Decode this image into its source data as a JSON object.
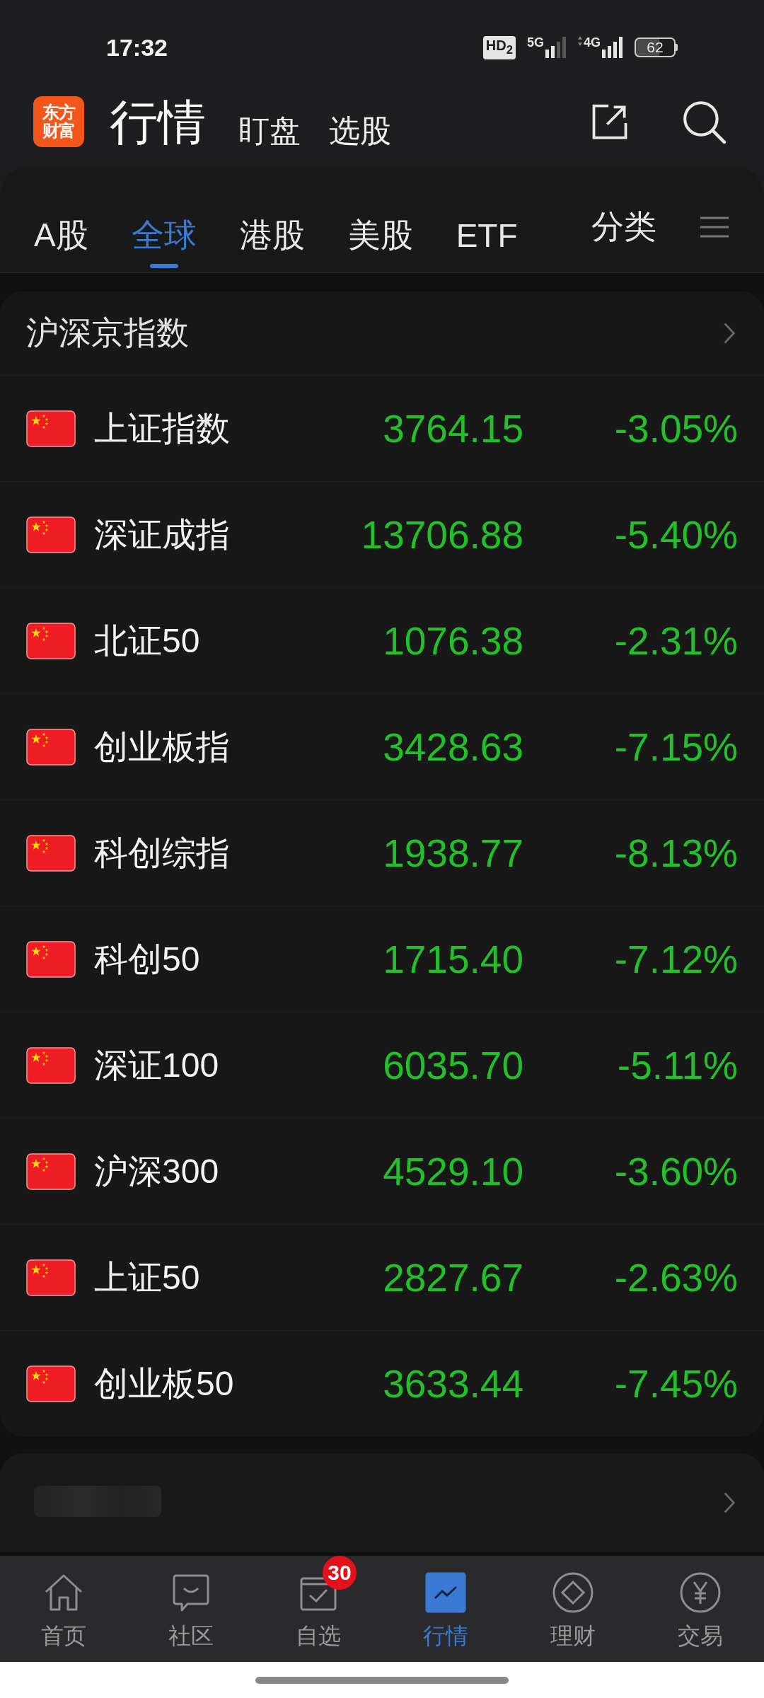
{
  "status_bar": {
    "time": "17:32",
    "hd_badge": "HD$_{2}$",
    "sim1_label": "5G",
    "sim2_label": "4G",
    "battery": "62"
  },
  "header": {
    "logo_lines": [
      "东方",
      "财富"
    ],
    "title": "行情",
    "links": [
      "盯盘",
      "选股"
    ]
  },
  "tabs": [
    {
      "label": "A股",
      "selected": false
    },
    {
      "label": "全球",
      "selected": true
    },
    {
      "label": "港股",
      "selected": false
    },
    {
      "label": "美股",
      "selected": false
    },
    {
      "label": "ETF",
      "selected": false
    }
  ],
  "category_button": {
    "label": "分类"
  },
  "index_section": {
    "title": "沪深京指数",
    "rows": [
      {
        "name": "上证指数",
        "value": "3764.15",
        "change": "-3.05%",
        "falling": true
      },
      {
        "name": "深证成指",
        "value": "13706.88",
        "change": "-5.40%",
        "falling": true
      },
      {
        "name": "北证50",
        "value": "1076.38",
        "change": "-2.31%",
        "falling": true
      },
      {
        "name": "创业板指",
        "value": "3428.63",
        "change": "-7.15%",
        "falling": true
      },
      {
        "name": "科创综指",
        "value": "1938.77",
        "change": "-8.13%",
        "falling": true
      },
      {
        "name": "科创50",
        "value": "1715.40",
        "change": "-7.12%",
        "falling": true
      },
      {
        "name": "深证100",
        "value": "6035.70",
        "change": "-5.11%",
        "falling": true
      },
      {
        "name": "沪深300",
        "value": "4529.10",
        "change": "-3.60%",
        "falling": true
      },
      {
        "name": "上证50",
        "value": "2827.67",
        "change": "-2.63%",
        "falling": true
      },
      {
        "name": "创业板50",
        "value": "3633.44",
        "change": "-7.45%",
        "falling": true
      }
    ]
  },
  "bottom_nav": [
    {
      "label": "首页",
      "kind": "home",
      "selected": false
    },
    {
      "label": "社区",
      "kind": "community",
      "selected": false
    },
    {
      "label": "自选",
      "kind": "watchlist",
      "selected": false,
      "badge": "30"
    },
    {
      "label": "行情",
      "kind": "market",
      "selected": true
    },
    {
      "label": "理财",
      "kind": "finance",
      "selected": false
    },
    {
      "label": "交易",
      "kind": "trade",
      "selected": false
    }
  ]
}
